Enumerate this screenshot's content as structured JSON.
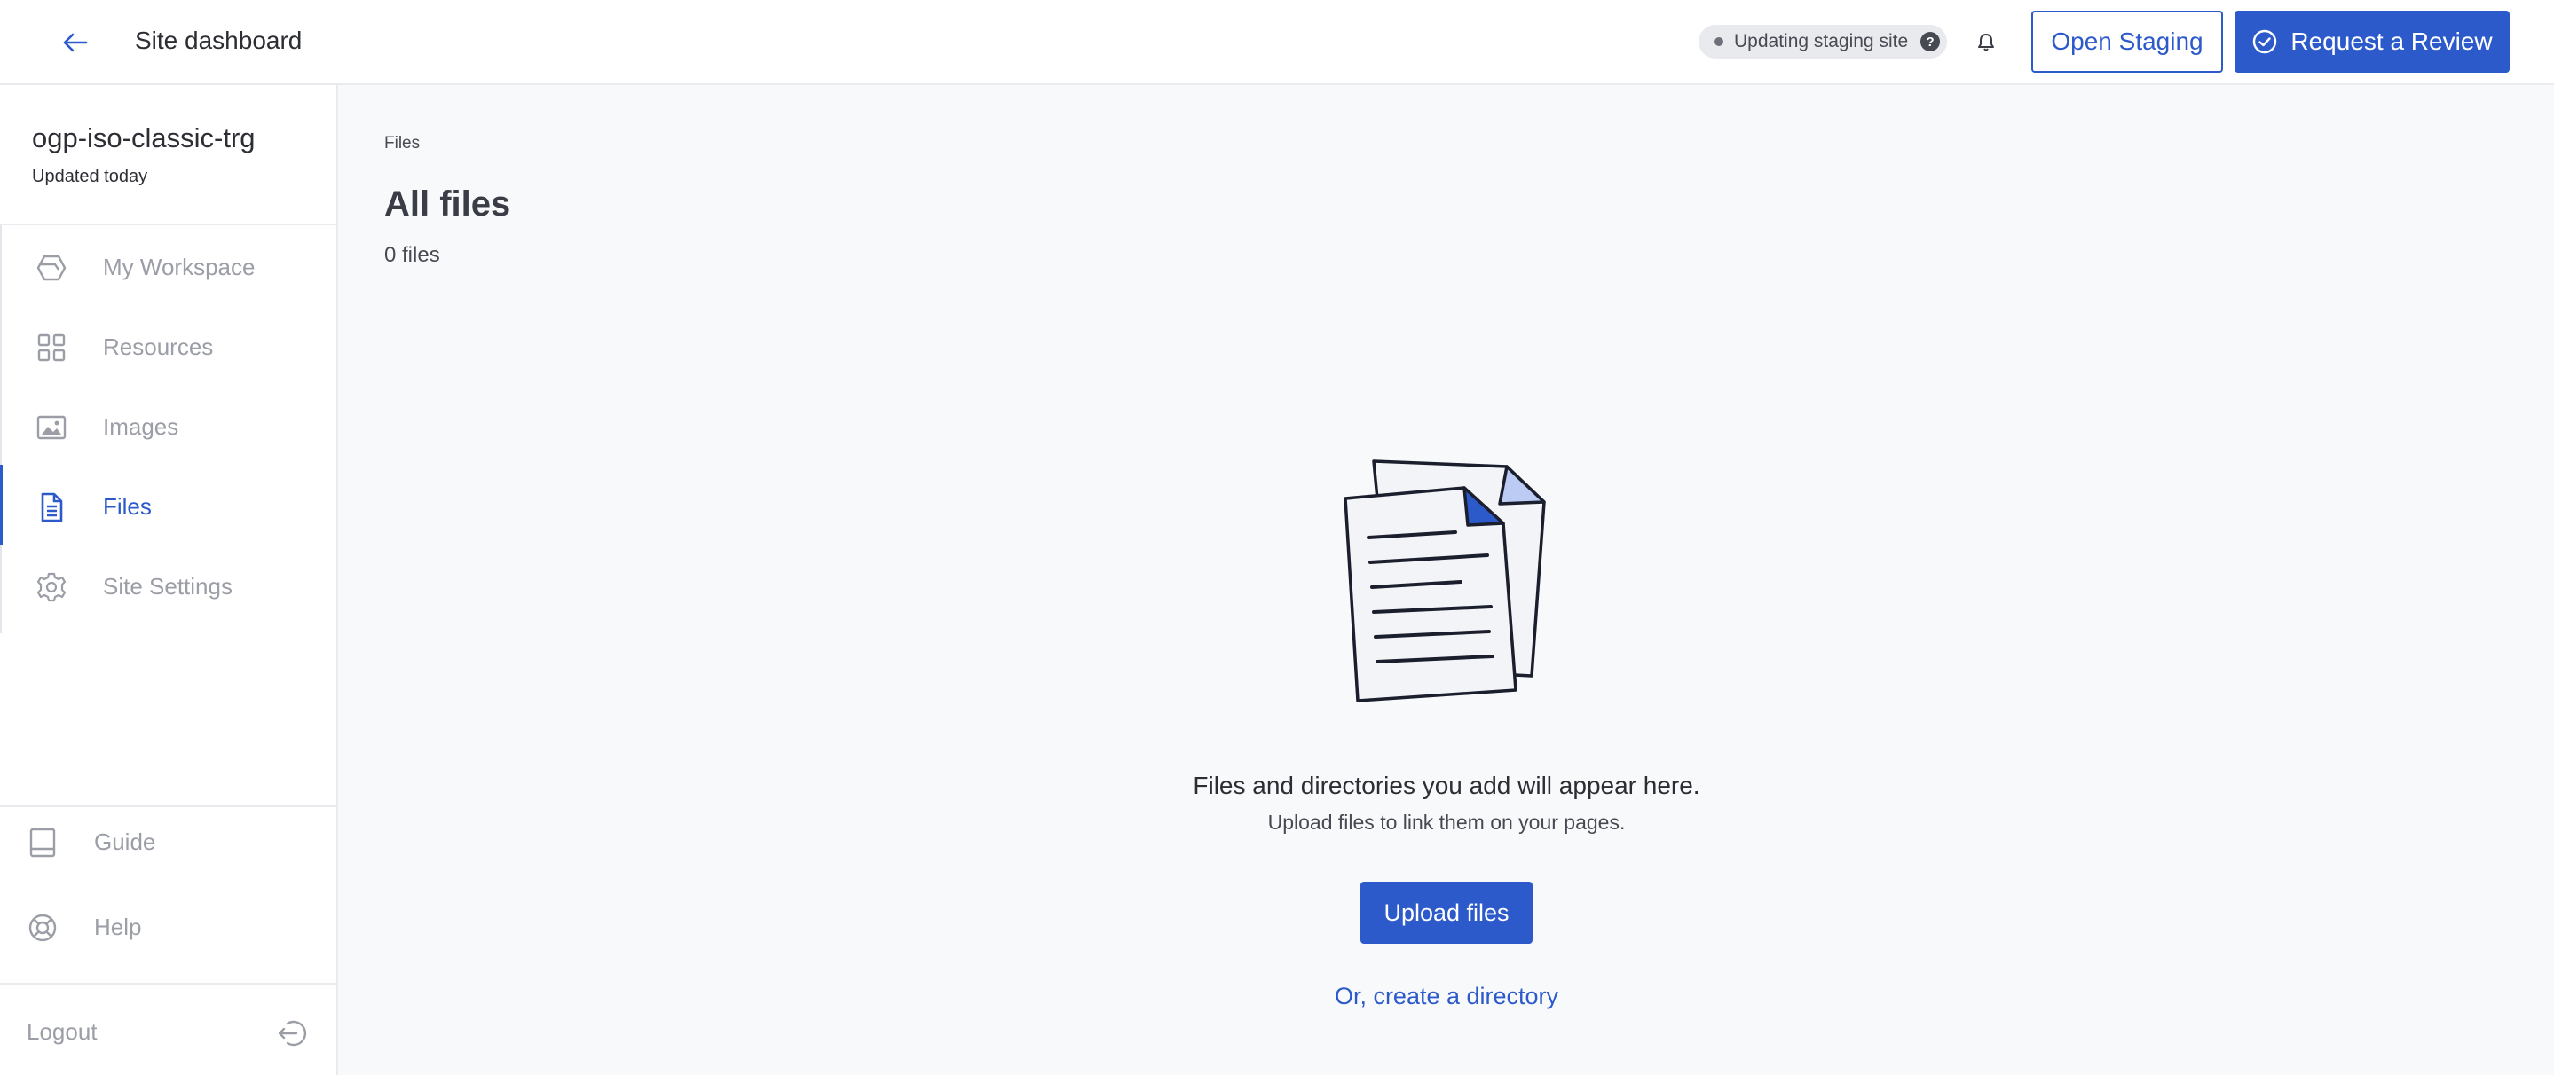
{
  "header": {
    "title": "Site dashboard",
    "status_text": "Updating staging site",
    "status_help": "?",
    "open_staging_label": "Open Staging",
    "request_review_label": "Request a Review"
  },
  "sidebar": {
    "site_name": "ogp-iso-classic-trg",
    "updated": "Updated today",
    "items": [
      {
        "label": "My Workspace",
        "icon": "workspace-icon",
        "active": false
      },
      {
        "label": "Resources",
        "icon": "grid-icon",
        "active": false
      },
      {
        "label": "Images",
        "icon": "image-icon",
        "active": false
      },
      {
        "label": "Files",
        "icon": "file-icon",
        "active": true
      },
      {
        "label": "Site Settings",
        "icon": "gear-icon",
        "active": false
      }
    ],
    "footer": {
      "guide_label": "Guide",
      "help_label": "Help",
      "logout_label": "Logout"
    }
  },
  "main": {
    "breadcrumb": "Files",
    "title": "All files",
    "count": "0 files",
    "empty": {
      "title": "Files and directories you add will appear here.",
      "subtitle": "Upload files to link them on your pages.",
      "upload_label": "Upload files",
      "create_dir_label": "Or, create a directory"
    }
  },
  "colors": {
    "accent": "#2d5acb",
    "muted": "#9b9ea6",
    "background": "#f8f9fb"
  }
}
